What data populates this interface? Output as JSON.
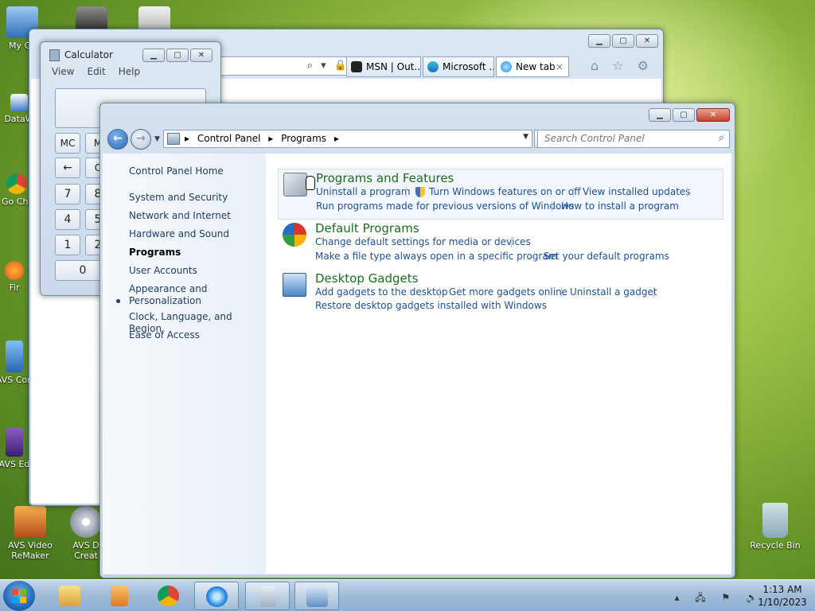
{
  "desktop": {
    "icons": [
      {
        "label": "My Co"
      },
      {
        "label": "DataW"
      },
      {
        "label": "Go Chr"
      },
      {
        "label": "Fir"
      },
      {
        "label": "AVS Con"
      },
      {
        "label": "AVS Ed"
      },
      {
        "label": "AVS Video ReMaker"
      },
      {
        "label": "AVS D Creat"
      },
      {
        "label": "Recycle Bin"
      }
    ]
  },
  "browser": {
    "tabs": [
      {
        "label": "MSN | Out..."
      },
      {
        "label": "Microsoft ..."
      },
      {
        "label": "New tab",
        "close": "×"
      }
    ],
    "address_symbols": "⌕ ▾ 🔒 ↻",
    "tools": "⌂ ☆ ⚙"
  },
  "calculator": {
    "title": "Calculator",
    "menu": [
      "View",
      "Edit",
      "Help"
    ],
    "buttons": [
      "MC",
      "M",
      "←",
      "C",
      "7",
      "8",
      "4",
      "5",
      "1",
      "2",
      "0"
    ]
  },
  "control_panel": {
    "address": {
      "crumbs": [
        "Control Panel",
        "Programs"
      ],
      "separator": "▸"
    },
    "search_placeholder": "Search Control Panel",
    "left_nav": {
      "home": "Control Panel Home",
      "items": [
        "System and Security",
        "Network and Internet",
        "Hardware and Sound",
        "Programs",
        "User Accounts",
        "Appearance and",
        "Personalization",
        "Clock, Language, and Region",
        "Ease of Access"
      ]
    },
    "categories": [
      {
        "title": "Programs and Features",
        "links": [
          "Uninstall a program",
          "Turn Windows features on or off",
          "View installed updates",
          "Run programs made for previous versions of Windows",
          "How to install a program"
        ]
      },
      {
        "title": "Default Programs",
        "links": [
          "Change default settings for media or devices",
          "Make a file type always open in a specific program",
          "Set your default programs"
        ]
      },
      {
        "title": "Desktop Gadgets",
        "links": [
          "Add gadgets to the desktop",
          "Get more gadgets online",
          "Uninstall a gadget",
          "Restore desktop gadgets installed with Windows"
        ]
      }
    ]
  },
  "taskbar": {
    "tray_icons": "▴ 🖧 ⚑ 🔊",
    "time": "1:13 AM",
    "date": "1/10/2023"
  }
}
